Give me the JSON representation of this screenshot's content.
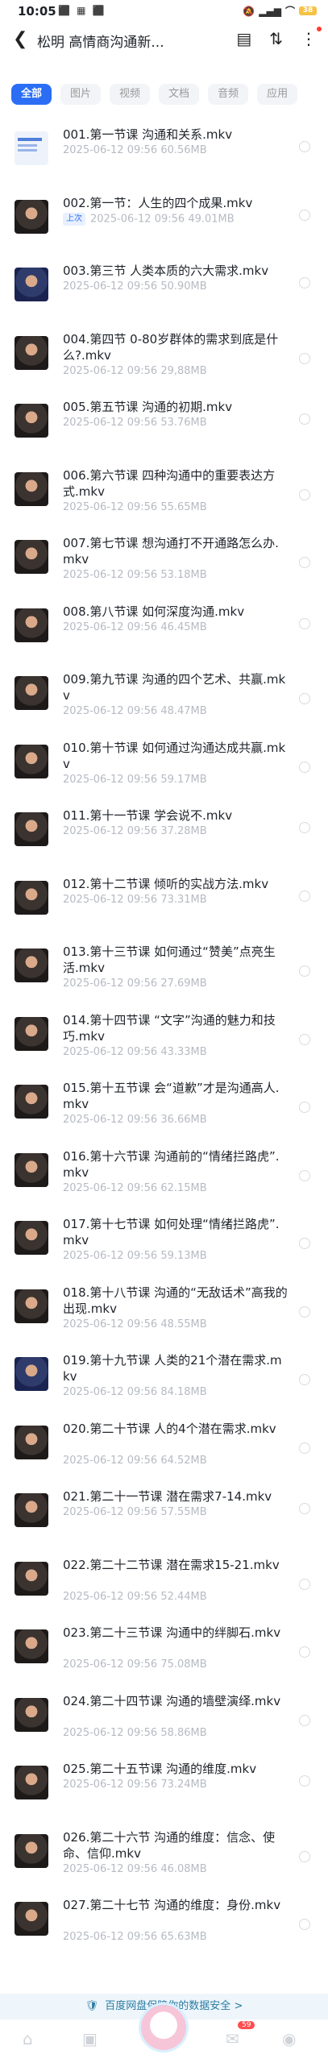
{
  "status": {
    "time": "10:05",
    "battery": "38"
  },
  "header": {
    "title": "松明 高情商沟通新..."
  },
  "tabs": [
    {
      "label": "全部",
      "active": true
    },
    {
      "label": "图片"
    },
    {
      "label": "视频"
    },
    {
      "label": "文档"
    },
    {
      "label": "音频"
    },
    {
      "label": "应用"
    }
  ],
  "files": [
    {
      "name": "001.第一节课 沟通和关系.mkv",
      "date": "2025-06-12",
      "time": "09:56",
      "size": "60.56MB",
      "thumb": "doc",
      "lines": 1
    },
    {
      "name": "002.第一节：人生的四个成果.mkv",
      "date": "2025-06-12",
      "time": "09:56",
      "size": "49.01MB",
      "badge": "上次",
      "lines": 1
    },
    {
      "name": "003.第三节 人类本质的六大需求.mkv",
      "date": "2025-06-12",
      "time": "09:56",
      "size": "50.90MB",
      "thumb": "blue",
      "lines": 1
    },
    {
      "name": "004.第四节 0-80岁群体的需求到底是什么?.mkv",
      "date": "2025-06-12",
      "time": "09:56",
      "size": "29,88MB",
      "lines": 2
    },
    {
      "name": "005.第五节课 沟通的初期.mkv",
      "date": "2025-06-12",
      "time": "09:56",
      "size": "53.76MB",
      "lines": 1
    },
    {
      "name": "006.第六节课 四种沟通中的重要表达方式.mkv",
      "date": "2025-06-12",
      "time": "09:56",
      "size": "55.65MB",
      "lines": 2
    },
    {
      "name": "007.第七节课 想沟通打不开通路怎么办.mkv",
      "date": "2025-06-12",
      "time": "09:56",
      "size": "53.18MB",
      "lines": 2
    },
    {
      "name": "008.第八节课 如何深度沟通.mkv",
      "date": "2025-06-12",
      "time": "09:56",
      "size": "46.45MB",
      "lines": 1
    },
    {
      "name": "009.第九节课 沟通的四个艺术、共赢.mkv",
      "date": "2025-06-12",
      "time": "09:56",
      "size": "48.47MB",
      "lines": 2
    },
    {
      "name": "010.第十节课 如何通过沟通达成共赢.mkv",
      "date": "2025-06-12",
      "time": "09:56",
      "size": "59.17MB",
      "lines": 2
    },
    {
      "name": "011.第十一节课 学会说不.mkv",
      "date": "2025-06-12",
      "time": "09:56",
      "size": "37.28MB",
      "lines": 1
    },
    {
      "name": "012.第十二节课 倾听的实战方法.mkv",
      "date": "2025-06-12",
      "time": "09:56",
      "size": "73.31MB",
      "lines": 1
    },
    {
      "name": "013.第十三节课 如何通过“赞美”点亮生活.mkv",
      "date": "2025-06-12",
      "time": "09:56",
      "size": "27.69MB",
      "lines": 2
    },
    {
      "name": "014.第十四节课 “文字”沟通的魅力和技巧.mkv",
      "date": "2025-06-12",
      "time": "09:56",
      "size": "43.33MB",
      "lines": 2
    },
    {
      "name": "015.第十五节课 会“道歉”才是沟通高人.mkv",
      "date": "2025-06-12",
      "time": "09:56",
      "size": "36.66MB",
      "lines": 2
    },
    {
      "name": "016.第十六节课 沟通前的“情绪拦路虎”.mkv",
      "date": "2025-06-12",
      "time": "09:56",
      "size": "62.15MB",
      "lines": 2
    },
    {
      "name": "017.第十七节课 如何处理“情绪拦路虎”.mkv",
      "date": "2025-06-12",
      "time": "09:56",
      "size": "59.13MB",
      "lines": 2
    },
    {
      "name": "018.第十八节课 沟通的“无敌话术”高我的出现.mkv",
      "date": "2025-06-12",
      "time": "09:56",
      "size": "48.55MB",
      "lines": 2
    },
    {
      "name": "019.第十九节课 人类的21个潜在需求.mkv",
      "date": "2025-06-12",
      "time": "09:56",
      "size": "84.18MB",
      "thumb": "blue",
      "lines": 2
    },
    {
      "name": "020.第二十节课 人的4个潜在需求.mkv",
      "date": "2025-06-12",
      "time": "09:56",
      "size": "64.52MB",
      "lines": 2
    },
    {
      "name": "021.第二十一节课 潜在需求7-14.mkv",
      "date": "2025-06-12",
      "time": "09:56",
      "size": "57.55MB",
      "lines": 1
    },
    {
      "name": "022.第二十二节课 潜在需求15-21.mkv",
      "date": "2025-06-12",
      "time": "09:56",
      "size": "52.44MB",
      "lines": 2
    },
    {
      "name": "023.第二十三节课 沟通中的绊脚石.mkv",
      "date": "2025-06-12",
      "time": "09:56",
      "size": "75.08MB",
      "lines": 2
    },
    {
      "name": "024.第二十四节课 沟通的墙壁演绎.mkv",
      "date": "2025-06-12",
      "time": "09:56",
      "size": "58.86MB",
      "lines": 2
    },
    {
      "name": "025.第二十五节课 沟通的维度.mkv",
      "date": "2025-06-12",
      "time": "09:56",
      "size": "73.24MB",
      "lines": 1
    },
    {
      "name": "026.第二十六节 沟通的维度：信念、使命、信仰.mkv",
      "date": "2025-06-12",
      "time": "09:56",
      "size": "46.08MB",
      "lines": 2
    },
    {
      "name": "027.第二十七节 沟通的维度：身份.mkv",
      "date": "2025-06-12",
      "time": "09:56",
      "size": "65.63MB",
      "lines": 2
    }
  ],
  "banner": {
    "text": "百度网盘保障你的数据安全",
    "chevron": ">"
  },
  "bottom": {
    "badge_count": "59"
  }
}
